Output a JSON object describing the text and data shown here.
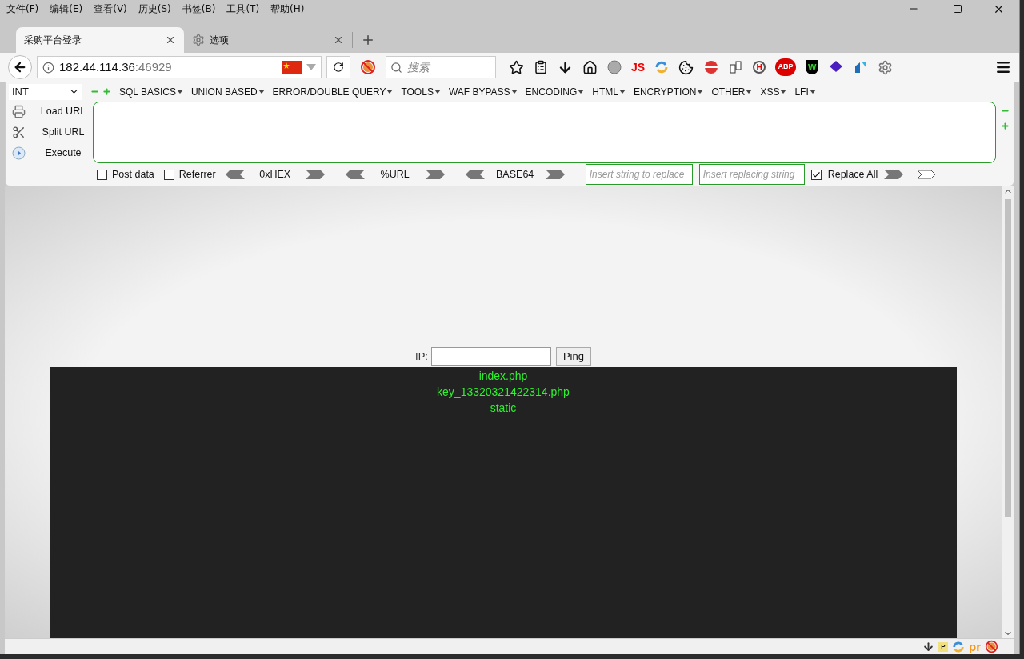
{
  "menu_bar": [
    "文件(F)",
    "编辑(E)",
    "查看(V)",
    "历史(S)",
    "书签(B)",
    "工具(T)",
    "帮助(H)"
  ],
  "tabs": [
    {
      "title": "采购平台登录",
      "selected": true,
      "kind": "page"
    },
    {
      "title": "选项",
      "selected": false,
      "kind": "settings"
    }
  ],
  "address": {
    "host": "182.44.114.36",
    "port": ":46929"
  },
  "search": {
    "placeholder": "搜索"
  },
  "extension_labels": {
    "js": "JS",
    "finder": "H",
    "adblock": "ABP",
    "shield": "W"
  },
  "hackbar": {
    "encoding": "INT",
    "menus": [
      "SQL BASICS",
      "UNION BASED",
      "ERROR/DOUBLE QUERY",
      "TOOLS",
      "WAF BYPASS",
      "ENCODING",
      "HTML",
      "ENCRYPTION",
      "OTHER",
      "XSS",
      "LFI"
    ],
    "actions": [
      {
        "label": "Load URL",
        "kind": "load"
      },
      {
        "label": "Split URL",
        "kind": "split"
      },
      {
        "label": "Execute",
        "kind": "execute"
      }
    ],
    "options": [
      {
        "label": "Post data",
        "checked": false
      },
      {
        "label": "Referrer",
        "checked": false
      }
    ],
    "converters": [
      "0xHEX",
      "%URL",
      "BASE64"
    ],
    "replace_from": {
      "placeholder": "Insert string to replace"
    },
    "replace_to": {
      "placeholder": "Insert replacing string"
    },
    "replace_all": {
      "label": "Replace All",
      "checked": true
    }
  },
  "page": {
    "ip_label": "IP:",
    "ping_button": "Ping",
    "output": [
      "index.php",
      "key_13320321422314.php",
      "static"
    ]
  },
  "status_bar": {
    "labels": [
      "P",
      "pr"
    ]
  }
}
